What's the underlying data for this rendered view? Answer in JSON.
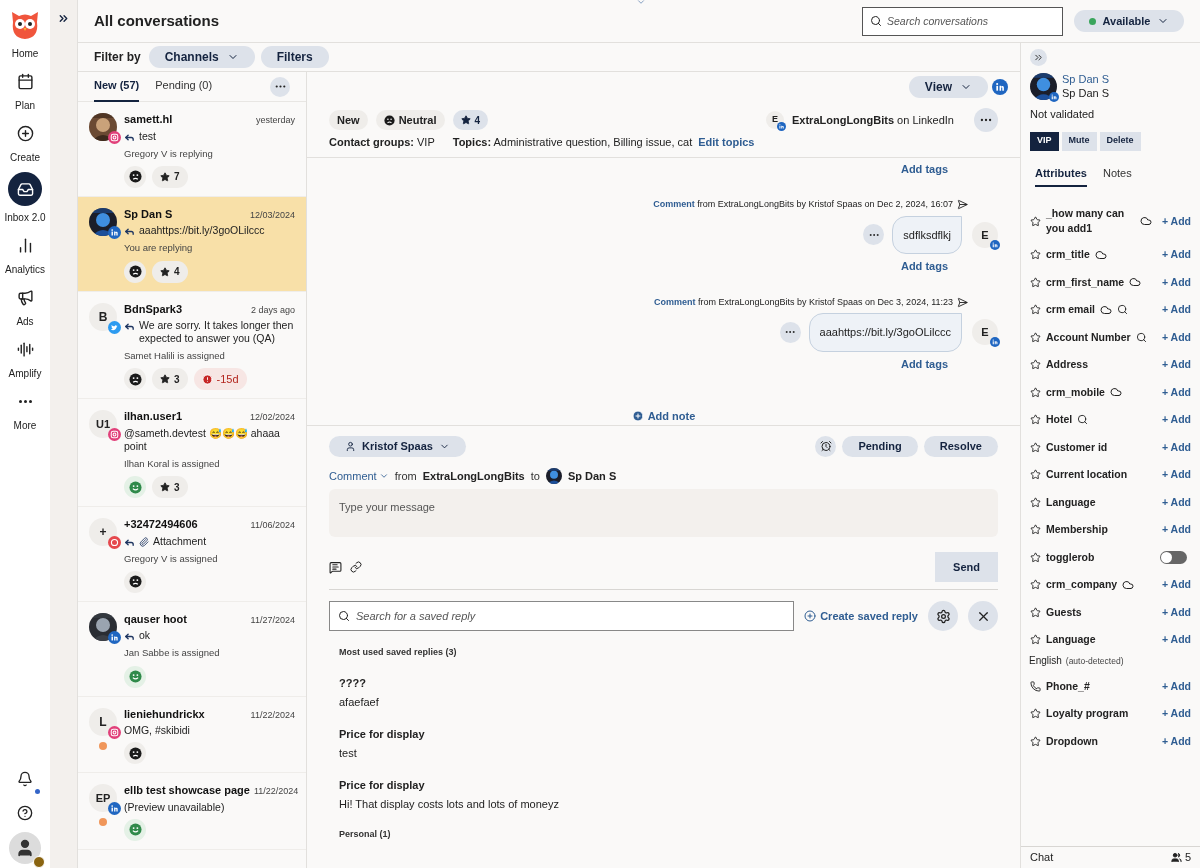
{
  "nav": {
    "items": [
      {
        "label": "Home",
        "selected": false
      },
      {
        "label": "Plan",
        "selected": false
      },
      {
        "label": "Create",
        "selected": false
      },
      {
        "label": "Inbox 2.0",
        "selected": true
      },
      {
        "label": "Analytics",
        "selected": false
      },
      {
        "label": "Ads",
        "selected": false
      },
      {
        "label": "Amplify",
        "selected": false
      },
      {
        "label": "More",
        "selected": false
      }
    ],
    "bottom": [
      {
        "kind": "bell",
        "dot": true
      },
      {
        "kind": "help",
        "dot": false
      }
    ],
    "user": {
      "warning": true
    }
  },
  "header": {
    "title": "All conversations",
    "search_placeholder": "Search conversations",
    "status": "Available"
  },
  "filter": {
    "label": "Filter by",
    "buttons": [
      {
        "label": "Channels",
        "dropdown": true
      },
      {
        "label": "Filters",
        "dropdown": false
      }
    ]
  },
  "list": {
    "tabs": [
      {
        "label": "New (57)",
        "selected": true
      },
      {
        "label": "Pending (0)",
        "selected": false
      }
    ],
    "conversations": [
      {
        "name": "samett.hl",
        "time": "yesterday",
        "badge": {
          "kind": "instagram"
        },
        "replied": true,
        "attachment": false,
        "preview": "test",
        "status": "Gregory V is replying",
        "sentiment": {
          "kind": "negative"
        },
        "rating": "7",
        "selected": false
      },
      {
        "name": "Sp Dan S",
        "time": "12/03/2024",
        "badge": {
          "kind": "linkedin"
        },
        "replied": true,
        "attachment": false,
        "preview": "aaahttps://bit.ly/3goOLilccc",
        "status": "You are replying",
        "sentiment": {
          "kind": "negative"
        },
        "rating": "4",
        "selected": true
      },
      {
        "name": "BdnSpark3",
        "time": "2 days ago",
        "avatar": {
          "kind": "initials",
          "text": "B"
        },
        "badge": {
          "kind": "twitter"
        },
        "replied": true,
        "attachment": false,
        "preview": "We are sorry. It takes longer then expected to answer you (QA)",
        "status": "Samet Halili is assigned",
        "sentiment": {
          "kind": "negative"
        },
        "rating": "3",
        "overdue": "-15d",
        "selected": false
      },
      {
        "name": "ilhan.user1",
        "time": "12/02/2024",
        "avatar": {
          "kind": "initials",
          "text": "U1"
        },
        "badge": {
          "kind": "instagram"
        },
        "replied": false,
        "attachment": false,
        "preview": "@sameth.devtest 😅😅😅 ahaaa point",
        "status": "Ilhan Koral is assigned",
        "sentiment": {
          "kind": "positive"
        },
        "rating": "3",
        "selected": false
      },
      {
        "name": "+32472494606",
        "time": "11/06/2024",
        "avatar": {
          "kind": "initials",
          "text": "+"
        },
        "badge": {
          "kind": "sms"
        },
        "replied": true,
        "attachment": true,
        "preview": "Attachment",
        "status": "Gregory V is assigned",
        "sentiment": {
          "kind": "negative"
        },
        "selected": false
      },
      {
        "name": "qauser hoot",
        "time": "11/27/2024",
        "badge": {
          "kind": "linkedin"
        },
        "replied": true,
        "attachment": false,
        "preview": "ok",
        "status": "Jan Sabbe is assigned",
        "sentiment": {
          "kind": "positive"
        },
        "selected": false
      },
      {
        "name": "lieniehundrickx",
        "time": "11/22/2024",
        "avatar": {
          "kind": "initials",
          "text": "L"
        },
        "badge": {
          "kind": "instagram"
        },
        "replied": false,
        "attachment": false,
        "preview": "OMG, #skibidi",
        "sentiment": {
          "kind": "negative"
        },
        "color": "#f0965a",
        "selected": false
      },
      {
        "name": "ellb test showcase page",
        "time": "11/22/2024",
        "avatar": {
          "kind": "initials",
          "text": "EP"
        },
        "badge": {
          "kind": "linkedin"
        },
        "replied": false,
        "attachment": false,
        "preview": "(Preview unavailable)",
        "sentiment": {
          "kind": "positive"
        },
        "color": "#f0965a",
        "selected": false
      }
    ]
  },
  "thread": {
    "view_button": "View",
    "tags": [
      {
        "kind": "status",
        "label": "New"
      },
      {
        "kind": "sentiment",
        "label": "Neutral"
      },
      {
        "kind": "rating",
        "label": "4"
      }
    ],
    "account": {
      "avatar": "E",
      "name": "ExtraLongLongBits",
      "suffix": "on LinkedIn"
    },
    "contact_groups": {
      "label": "Contact groups:",
      "value": "VIP"
    },
    "topics": {
      "label": "Topics:",
      "value": "Administrative question, Billing issue, cat",
      "link": "Edit topics"
    },
    "top_link": "Add tags",
    "messages": [
      {
        "type": "Comment",
        "meta": "from ExtraLongLongBits by Kristof Spaas on Dec 2, 2024, 16:07",
        "text": "sdflksdflkj",
        "avatar": "E",
        "link": "Add tags"
      },
      {
        "type": "Comment",
        "meta": "from ExtraLongLongBits by Kristof Spaas on Dec 3, 2024, 11:23",
        "text": "aaahttps://bit.ly/3goOLilccc",
        "avatar": "E",
        "link": "Add tags"
      }
    ],
    "add_note": "Add note"
  },
  "composer": {
    "assignee": "Kristof Spaas",
    "actions": [
      "Pending",
      "Resolve"
    ],
    "type": "Comment",
    "from_label": "from",
    "from": "ExtraLongLongBits",
    "to_label": "to",
    "to": "Sp Dan S",
    "placeholder": "Type your message",
    "send": "Send"
  },
  "saved_replies": {
    "search_placeholder": "Search for a saved reply",
    "create": "Create saved reply",
    "sections": [
      {
        "title": "Most used saved replies (3)",
        "items": [
          {
            "title": "????",
            "body": "afaefaef"
          },
          {
            "title": "Price for display",
            "body": "test"
          },
          {
            "title": "Price for display",
            "body": "Hi! That display costs lots and lots of moneyz"
          }
        ]
      },
      {
        "title": "Personal (1)"
      }
    ]
  },
  "contact": {
    "name_link": "Sp Dan S",
    "name": "Sp Dan S",
    "validation": "Not validated",
    "buttons": [
      {
        "label": "VIP",
        "active": true
      },
      {
        "label": "Mute",
        "active": false
      },
      {
        "label": "Delete",
        "active": false
      }
    ],
    "tabs": [
      {
        "label": "Attributes",
        "selected": true
      },
      {
        "label": "Notes",
        "selected": false
      }
    ],
    "attributes": [
      {
        "lead": {
          "kind": "star"
        },
        "name": "_how many can you add1",
        "icons": [
          {
            "kind": "cloud"
          }
        ],
        "kind": "add",
        "action": "+ Add"
      },
      {
        "lead": {
          "kind": "star"
        },
        "name": "crm_title",
        "icons": [
          {
            "kind": "cloud"
          }
        ],
        "kind": "add",
        "action": "+ Add"
      },
      {
        "lead": {
          "kind": "star"
        },
        "name": "crm_first_name",
        "icons": [
          {
            "kind": "cloud"
          }
        ],
        "kind": "add",
        "action": "+ Add"
      },
      {
        "lead": {
          "kind": "star"
        },
        "name": "crm email",
        "icons": [
          {
            "kind": "cloud"
          },
          {
            "kind": "search"
          }
        ],
        "kind": "add",
        "action": "+ Add"
      },
      {
        "lead": {
          "kind": "star"
        },
        "name": "Account Number",
        "icons": [
          {
            "kind": "search"
          }
        ],
        "kind": "add",
        "action": "+ Add"
      },
      {
        "lead": {
          "kind": "star"
        },
        "name": "Address",
        "kind": "add",
        "action": "+ Add"
      },
      {
        "lead": {
          "kind": "star"
        },
        "name": "crm_mobile",
        "icons": [
          {
            "kind": "cloud"
          }
        ],
        "kind": "add",
        "action": "+ Add"
      },
      {
        "lead": {
          "kind": "star"
        },
        "name": "Hotel",
        "icons": [
          {
            "kind": "search"
          }
        ],
        "kind": "add",
        "action": "+ Add"
      },
      {
        "lead": {
          "kind": "star"
        },
        "name": "Customer id",
        "kind": "add",
        "action": "+ Add"
      },
      {
        "lead": {
          "kind": "star"
        },
        "name": "Current location",
        "kind": "add",
        "action": "+ Add"
      },
      {
        "lead": {
          "kind": "star"
        },
        "name": "Language",
        "kind": "add",
        "action": "+ Add"
      },
      {
        "lead": {
          "kind": "star"
        },
        "name": "Membership",
        "kind": "add",
        "action": "+ Add"
      },
      {
        "lead": {
          "kind": "star"
        },
        "name": "togglerob",
        "kind": "toggle",
        "on": false
      },
      {
        "lead": {
          "kind": "star"
        },
        "name": "crm_company",
        "icons": [
          {
            "kind": "cloud"
          }
        ],
        "kind": "add",
        "action": "+ Add"
      },
      {
        "lead": {
          "kind": "star"
        },
        "name": "Guests",
        "kind": "add",
        "action": "+ Add"
      },
      {
        "lead": {
          "kind": "star"
        },
        "name": "Language",
        "kind": "add",
        "action": "+ Add",
        "value": "English",
        "note": "(auto-detected)"
      },
      {
        "lead": {
          "kind": "phone"
        },
        "name": "Phone_#",
        "kind": "add",
        "action": "+ Add"
      },
      {
        "lead": {
          "kind": "star"
        },
        "name": "Loyalty program",
        "kind": "add",
        "action": "+ Add"
      },
      {
        "lead": {
          "kind": "star"
        },
        "name": "Dropdown",
        "kind": "add",
        "action": "+ Add"
      }
    ],
    "footer": {
      "label": "Chat",
      "count": "5"
    }
  }
}
